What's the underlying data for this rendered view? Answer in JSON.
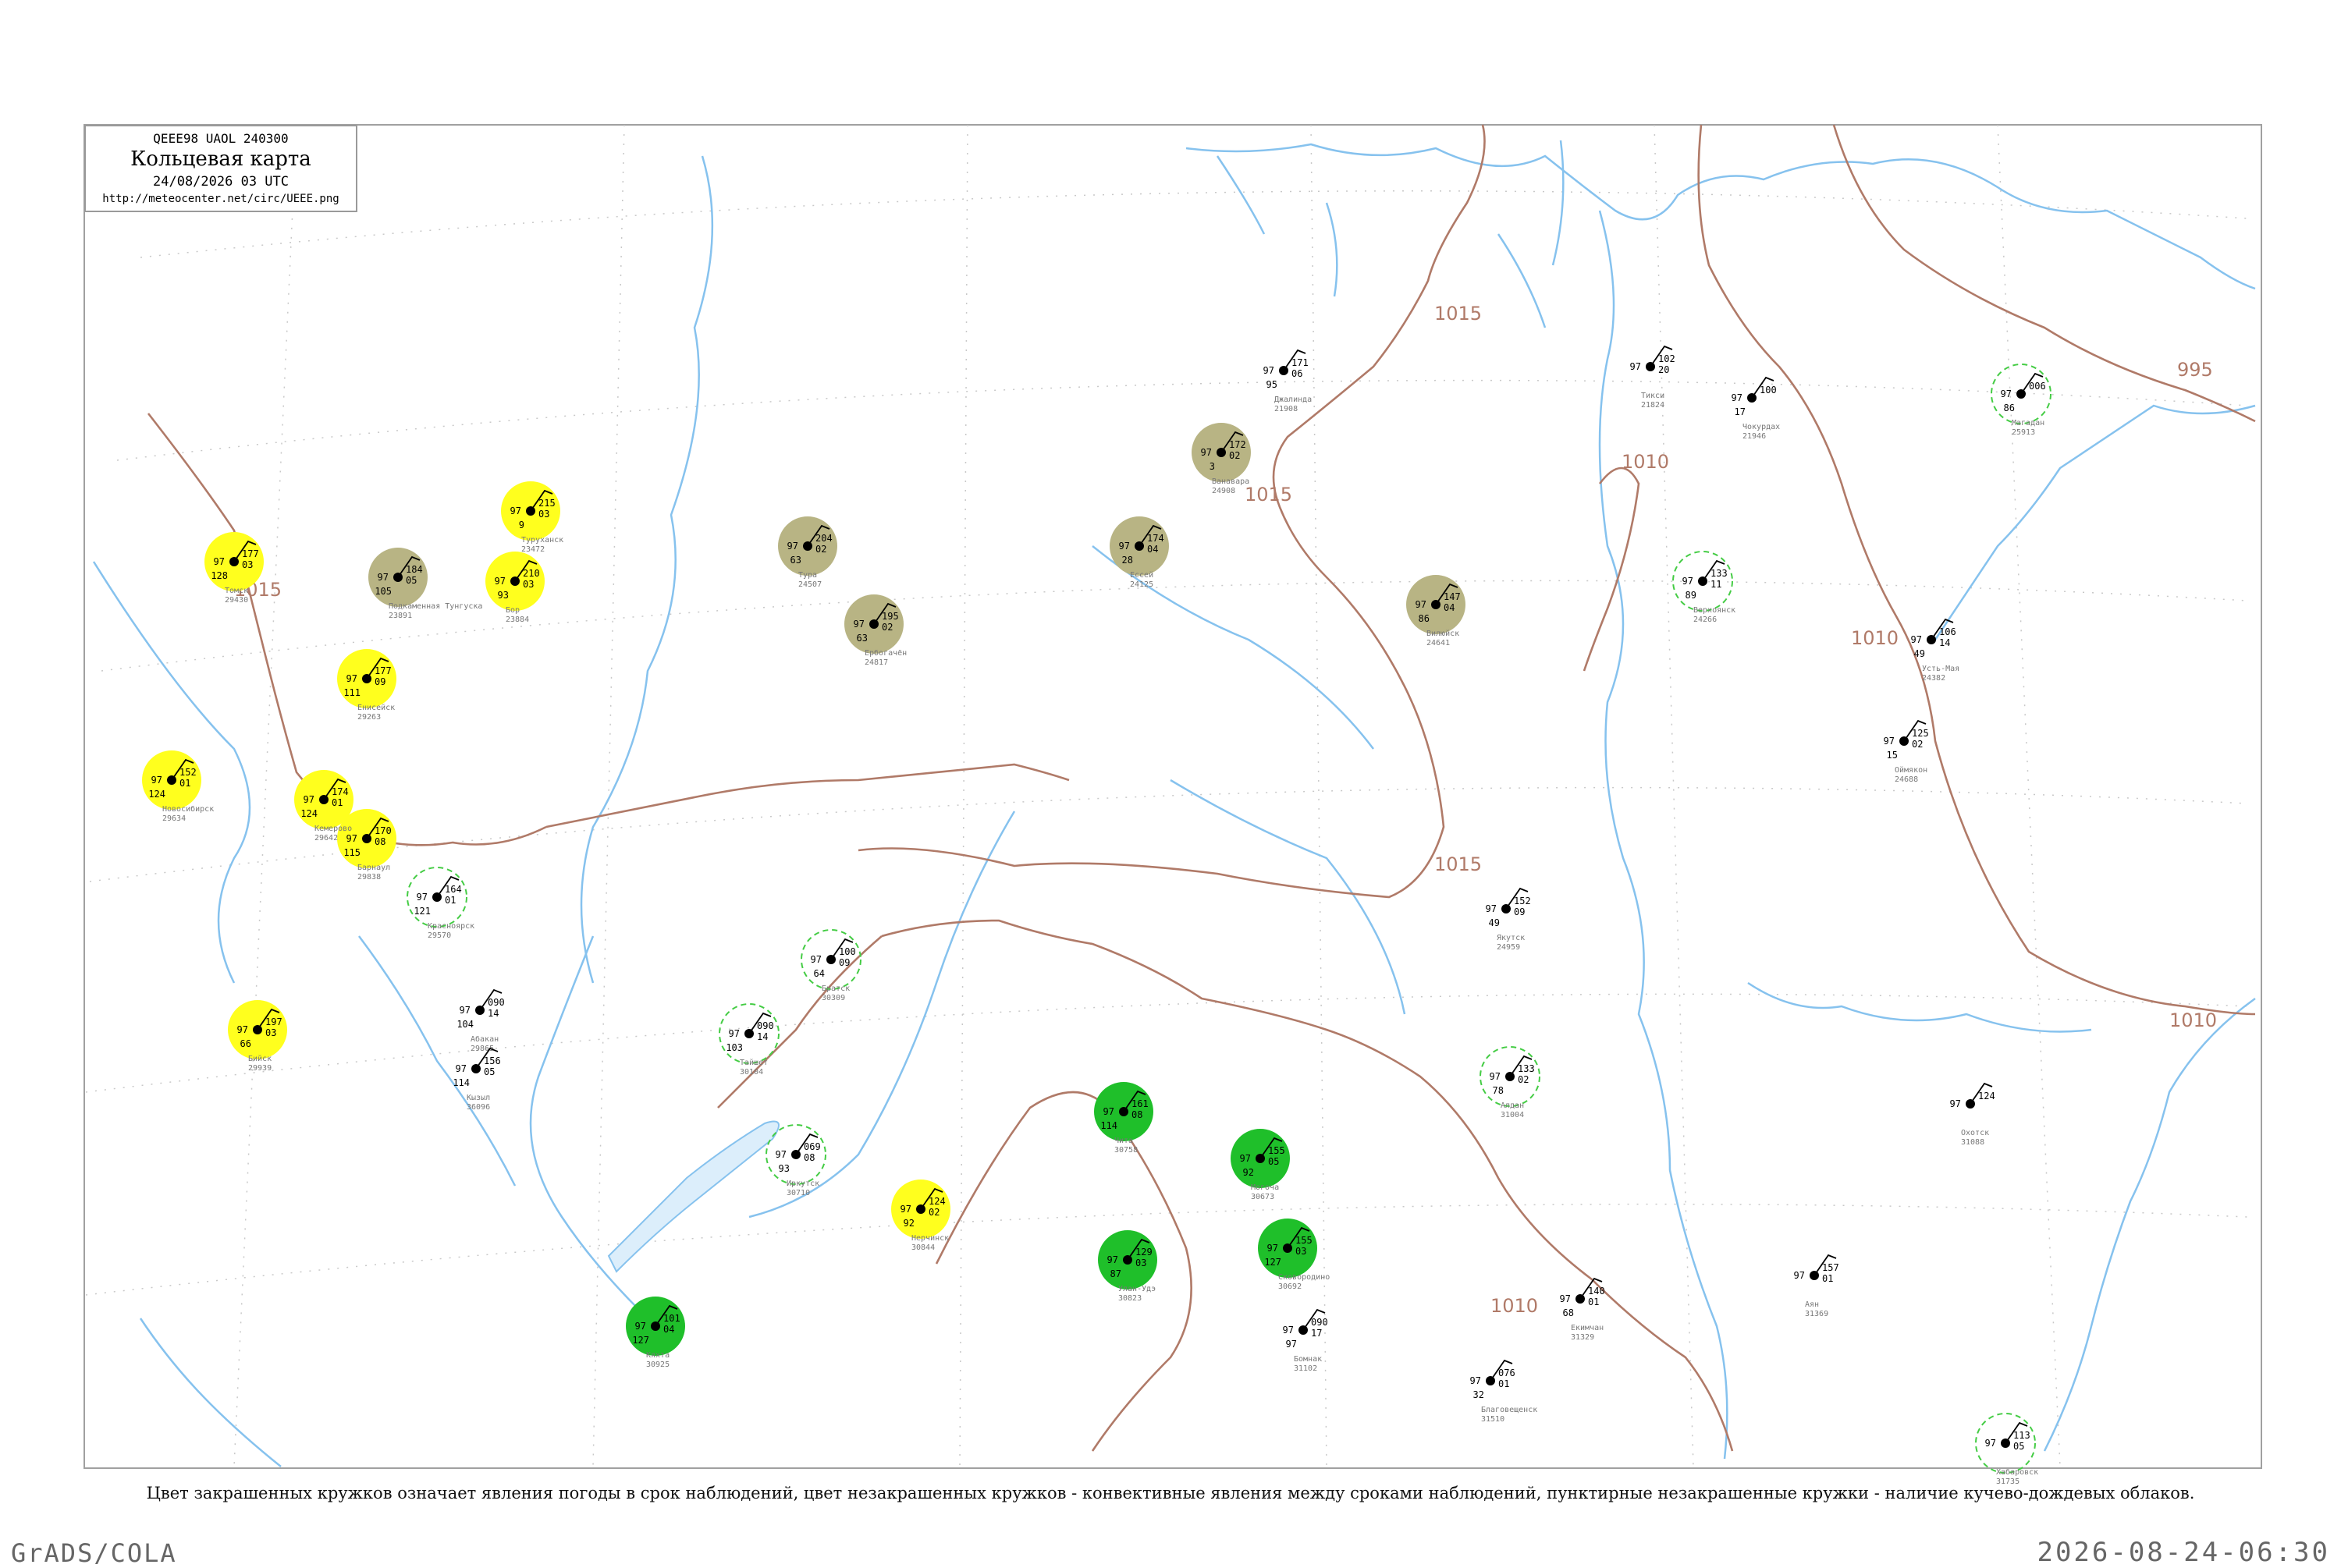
{
  "header": {
    "code_line": "QEEE98  UAOL  240300",
    "title": "Кольцевая карта",
    "time": "24/08/2026 03 UTC",
    "url": "http://meteocenter.net/circ/UEEE.png"
  },
  "caption": "Цвет закрашенных кружков означает явления погоды в срок наблюдений, цвет незакрашенных кружков - конвективные явления между сроками наблюдений, пунктирные незакрашенные кружки - наличие кучево-дождевых облаков.",
  "footer": {
    "software": "GrADS/COLA",
    "datetime": "2026-08-24-06:30"
  },
  "colors": {
    "isobar": "#b07a68",
    "river": "#86c2ee",
    "olive_circle": "#b8b484",
    "yellow_circle": "#ffff1e",
    "green_circle": "#1fbf2a",
    "dashed_circle": "#44cc44",
    "station_name": "#777777"
  },
  "isobars": [
    {
      "label": "1015"
    },
    {
      "label": "1015"
    },
    {
      "label": "1015"
    },
    {
      "label": "1015"
    },
    {
      "label": "1010"
    },
    {
      "label": "1010"
    },
    {
      "label": "1010"
    },
    {
      "label": "1010"
    },
    {
      "label": "995"
    }
  ],
  "stations": [
    {
      "name": "Тикси",
      "code": "21824",
      "t": "102",
      "p": "20",
      "d": "",
      "circle": "none"
    },
    {
      "name": "Джалинда",
      "code": "21908",
      "t": "171",
      "p": "06",
      "d": "95",
      "circle": "none"
    },
    {
      "name": "Чокурдах",
      "code": "21946",
      "t": "100",
      "p": "",
      "d": "17",
      "circle": "none"
    },
    {
      "name": "Оймякон",
      "code": "24688",
      "t": "125",
      "p": "02",
      "d": "15",
      "circle": "none"
    },
    {
      "name": "Верхоянск",
      "code": "24266",
      "t": "133",
      "p": "11",
      "d": "89",
      "circle": "dashed"
    },
    {
      "name": "Усть-Мая",
      "code": "24382",
      "t": "106",
      "p": "14",
      "d": "49",
      "circle": "none"
    },
    {
      "name": "Ванавара",
      "code": "24908",
      "t": "172",
      "p": "02",
      "d": "3",
      "circle": "olive"
    },
    {
      "name": "Тура",
      "code": "24507",
      "t": "204",
      "p": "02",
      "d": "63",
      "circle": "olive"
    },
    {
      "name": "Ербогачён",
      "code": "24817",
      "t": "195",
      "p": "02",
      "d": "63",
      "circle": "olive"
    },
    {
      "name": "Туруханск",
      "code": "23472",
      "t": "215",
      "p": "03",
      "d": "9",
      "circle": "yellow"
    },
    {
      "name": "Бор",
      "code": "23884",
      "t": "210",
      "p": "03",
      "d": "93",
      "circle": "yellow"
    },
    {
      "name": "Енисейск",
      "code": "29263",
      "t": "177",
      "p": "09",
      "d": "111",
      "circle": "yellow"
    },
    {
      "name": "Подкаменная Тунгуска",
      "code": "23891",
      "t": "184",
      "p": "05",
      "d": "105",
      "circle": "olive"
    },
    {
      "name": "Ессей",
      "code": "24125",
      "t": "174",
      "p": "04",
      "d": "28",
      "circle": "olive"
    },
    {
      "name": "Вилюйск",
      "code": "24641",
      "t": "147",
      "p": "04",
      "d": "86",
      "circle": "olive"
    },
    {
      "name": "Якутск",
      "code": "24959",
      "t": "152",
      "p": "09",
      "d": "49",
      "circle": "none"
    },
    {
      "name": "Алдан",
      "code": "31004",
      "t": "133",
      "p": "02",
      "d": "78",
      "circle": "dashed"
    },
    {
      "name": "Чита",
      "code": "30758",
      "t": "161",
      "p": "08",
      "d": "114",
      "circle": "green"
    },
    {
      "name": "Могоча",
      "code": "30673",
      "t": "155",
      "p": "05",
      "d": "92",
      "circle": "green"
    },
    {
      "name": "Сковородино",
      "code": "30692",
      "t": "155",
      "p": "03",
      "d": "127",
      "circle": "green"
    },
    {
      "name": "Улан-Удэ",
      "code": "30823",
      "t": "129",
      "p": "03",
      "d": "87",
      "circle": "green"
    },
    {
      "name": "Кяхта",
      "code": "30925",
      "t": "101",
      "p": "04",
      "d": "127",
      "circle": "green"
    },
    {
      "name": "Братск",
      "code": "30309",
      "t": "100",
      "p": "09",
      "d": "64",
      "circle": "dashed"
    },
    {
      "name": "Иркутск",
      "code": "30710",
      "t": "069",
      "p": "08",
      "d": "93",
      "circle": "dashed"
    },
    {
      "name": "Томск",
      "code": "29430",
      "t": "177",
      "p": "03",
      "d": "128",
      "circle": "yellow"
    },
    {
      "name": "Новосибирск",
      "code": "29634",
      "t": "152",
      "p": "01",
      "d": "124",
      "circle": "yellow"
    },
    {
      "name": "Барнаул",
      "code": "29838",
      "t": "170",
      "p": "08",
      "d": "115",
      "circle": "yellow"
    },
    {
      "name": "Бийск",
      "code": "29939",
      "t": "197",
      "p": "03",
      "d": "66",
      "circle": "yellow"
    },
    {
      "name": "Кемерово",
      "code": "29642",
      "t": "174",
      "p": "01",
      "d": "124",
      "circle": "yellow"
    },
    {
      "name": "Красноярск",
      "code": "29570",
      "t": "164",
      "p": "01",
      "d": "121",
      "circle": "dashed"
    },
    {
      "name": "Абакан",
      "code": "29865",
      "t": "090",
      "p": "14",
      "d": "104",
      "circle": "none"
    },
    {
      "name": "Кызыл",
      "code": "36096",
      "t": "156",
      "p": "05",
      "d": "114",
      "circle": "none"
    },
    {
      "name": "Тайшет",
      "code": "30104",
      "t": "090",
      "p": "14",
      "d": "103",
      "circle": "dashed"
    },
    {
      "name": "Нерчинск",
      "code": "30844",
      "t": "124",
      "p": "02",
      "d": "92",
      "circle": "yellow"
    },
    {
      "name": "Бомнак",
      "code": "31102",
      "t": "090",
      "p": "17",
      "d": "97",
      "circle": "none"
    },
    {
      "name": "Благовещенск",
      "code": "31510",
      "t": "076",
      "p": "01",
      "d": "32",
      "circle": "none"
    },
    {
      "name": "Екимчан",
      "code": "31329",
      "t": "140",
      "p": "01",
      "d": "68",
      "circle": "none"
    },
    {
      "name": "Аян",
      "code": "31369",
      "t": "157",
      "p": "01",
      "d": "",
      "circle": "none"
    },
    {
      "name": "Охотск",
      "code": "31088",
      "t": "124",
      "p": "",
      "d": "",
      "circle": "none"
    },
    {
      "name": "Магадан",
      "code": "25913",
      "t": "006",
      "p": "",
      "d": "86",
      "circle": "dashed"
    },
    {
      "name": "Хабаровск",
      "code": "31735",
      "t": "113",
      "p": "05",
      "d": "",
      "circle": "dashed"
    }
  ]
}
